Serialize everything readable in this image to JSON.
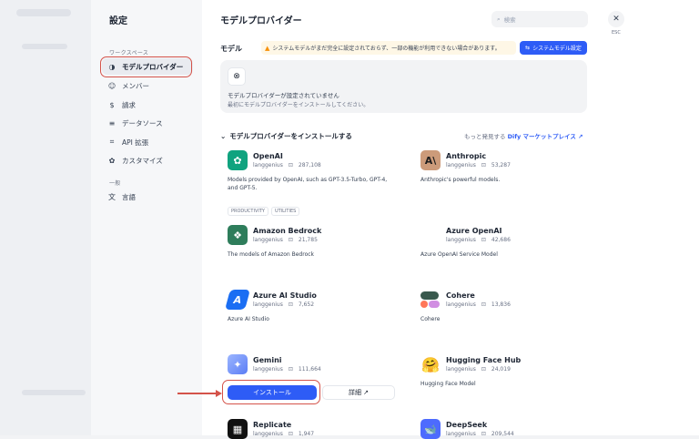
{
  "sidebar": {
    "title": "設定",
    "workspace_section": "ワークスペース",
    "general_section": "一般",
    "items": [
      {
        "label": "モデルプロバイダー",
        "icon": "brain-icon"
      },
      {
        "label": "メンバー",
        "icon": "users-icon"
      },
      {
        "label": "請求",
        "icon": "billing-icon"
      },
      {
        "label": "データソース",
        "icon": "database-icon"
      },
      {
        "label": "API 拡張",
        "icon": "api-icon"
      },
      {
        "label": "カスタマイズ",
        "icon": "customize-icon"
      }
    ],
    "general_items": [
      {
        "label": "言語",
        "icon": "language-icon"
      }
    ]
  },
  "main": {
    "title": "モデルプロバイダー",
    "search_placeholder": "検索",
    "model_label": "モデル",
    "warning": "システムモデルがまだ完全に設定されておらず、一部の機能が利用できない場合があります。",
    "system_model_button": "システムモデル設定",
    "empty_title": "モデルプロバイダーが設定されていません",
    "empty_subtitle": "最初にモデルプロバイダーをインストールしてください。",
    "install_heading": "モデルプロバイダーをインストールする",
    "market_prefix": "もっと発見する",
    "market_link": "Dify マーケットプレイス ↗"
  },
  "providers": [
    {
      "name": "OpenAI",
      "author": "langgenius",
      "downloads": "287,108",
      "desc": "Models provided by OpenAI, such as GPT-3.5-Turbo, GPT-4, and GPT-5.",
      "tags": [
        "PRODUCTIVITY",
        "UTILITIES"
      ],
      "color": "#10a37f"
    },
    {
      "name": "Anthropic",
      "author": "langgenius",
      "downloads": "53,287",
      "desc": "Anthropic's powerful models.",
      "tags": [],
      "color": "#d4a27f"
    },
    {
      "name": "Amazon Bedrock",
      "author": "langgenius",
      "downloads": "21,785",
      "desc": "The models of Amazon Bedrock",
      "tags": [],
      "color": "#2e7d5b"
    },
    {
      "name": "Azure OpenAI",
      "author": "langgenius",
      "downloads": "42,686",
      "desc": "Azure OpenAI Service Model",
      "tags": [],
      "color": "#f25022"
    },
    {
      "name": "Azure AI Studio",
      "author": "langgenius",
      "downloads": "7,652",
      "desc": "Azure AI Studio",
      "tags": [],
      "color": "#1b6ef3"
    },
    {
      "name": "Cohere",
      "author": "langgenius",
      "downloads": "13,836",
      "desc": "Cohere",
      "tags": [],
      "color": "#39594d"
    },
    {
      "name": "Gemini",
      "author": "langgenius",
      "downloads": "111,664",
      "desc": "",
      "tags": [],
      "color": "#6c8cf5"
    },
    {
      "name": "Hugging Face Hub",
      "author": "langgenius",
      "downloads": "24,019",
      "desc": "Hugging Face Model",
      "tags": [],
      "color": "#ffd21e"
    },
    {
      "name": "Replicate",
      "author": "langgenius",
      "downloads": "1,947",
      "desc": "",
      "tags": [],
      "color": "#111111"
    },
    {
      "name": "DeepSeek",
      "author": "langgenius",
      "downloads": "209,544",
      "desc": "",
      "tags": [],
      "color": "#4d6bfe"
    }
  ],
  "install_button": "インストール",
  "detail_button": "詳細 ↗",
  "close_label": "ESC"
}
